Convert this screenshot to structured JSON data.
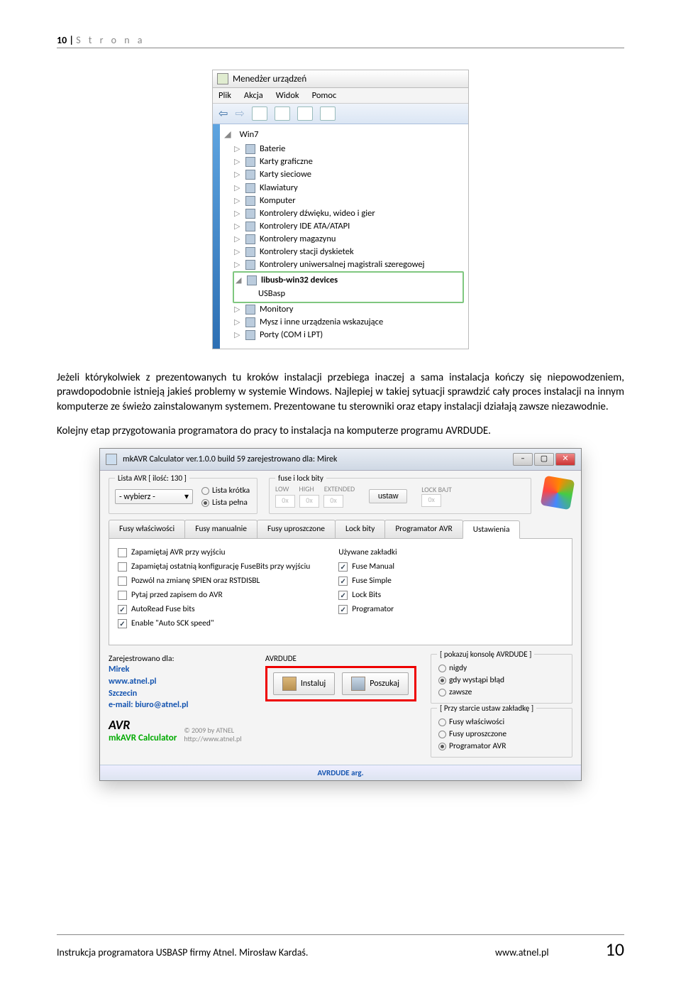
{
  "header": {
    "num": "10 | ",
    "label": "S t r o n a"
  },
  "devmgr": {
    "title": "Menedżer urządzeń",
    "menu": [
      "Plik",
      "Akcja",
      "Widok",
      "Pomoc"
    ],
    "root": "Win7",
    "items": [
      "Baterie",
      "Karty graficzne",
      "Karty sieciowe",
      "Klawiatury",
      "Komputer",
      "Kontrolery dźwięku, wideo i gier",
      "Kontrolery IDE ATA/ATAPI",
      "Kontrolery magazynu",
      "Kontrolery stacji dyskietek",
      "Kontrolery uniwersalnej magistrali szeregowej"
    ],
    "highlighted": {
      "parent": "libusb-win32 devices",
      "child": "USBasp"
    },
    "after": [
      "Monitory",
      "Mysz i inne urządzenia wskazujące",
      "Porty (COM i LPT)"
    ]
  },
  "para1": "Jeżeli którykolwiek z prezentowanych tu kroków instalacji przebiega inaczej a sama instalacja kończy się niepowodzeniem, prawdopodobnie istnieją jakieś problemy w systemie Windows. Najlepiej w takiej sytuacji sprawdzić cały proces instalacji na innym komputerze ze świeżo zainstalowanym systemem. Prezentowane tu sterowniki oraz etapy instalacji działają zawsze niezawodnie.",
  "para2": "Kolejny etap przygotowania programatora do pracy to instalacja na komputerze programu AVRDUDE.",
  "mkavr": {
    "title": "mkAVR Calculator ver.1.0.0 build 59  zarejestrowano dla: Mirek",
    "lista_label": "Lista AVR [ ilość: 130 ]",
    "select_value": "- wybierz -",
    "radio_short": "Lista krótka",
    "radio_full": "Lista pełna",
    "fuse_title": "fuse i lock bity",
    "fuse_cols": [
      "LOW",
      "HIGH",
      "EXTENDED"
    ],
    "hex": "0x",
    "ustaw": "ustaw",
    "lockbajt": "LOCK BAJT",
    "tabs": [
      "Fusy właściwości",
      "Fusy manualnie",
      "Fusy uproszczone",
      "Lock bity",
      "Programator AVR",
      "Ustawienia"
    ],
    "left_checks": [
      {
        "label": "Zapamiętaj AVR przy wyjściu",
        "checked": false
      },
      {
        "label": "Zapamiętaj ostatnią konfigurację FuseBits przy wyjściu",
        "checked": false
      },
      {
        "label": "Pozwól na zmianę SPIEN oraz RSTDISBL",
        "checked": false
      },
      {
        "label": "Pytaj przed zapisem do AVR",
        "checked": false
      },
      {
        "label": "AutoRead Fuse bits",
        "checked": true
      },
      {
        "label": "Enable \"Auto SCK speed\"",
        "checked": true
      }
    ],
    "uzk_title": "Używane zakładki",
    "right_checks": [
      {
        "label": "Fuse Manual",
        "checked": true
      },
      {
        "label": "Fuse Simple",
        "checked": true
      },
      {
        "label": "Lock Bits",
        "checked": true
      },
      {
        "label": "Programator",
        "checked": true
      }
    ],
    "reg_label": "Zarejestrowano dla:",
    "reg": [
      "Mirek",
      "www.atnel.pl",
      "Szczecin",
      "e-mail: biuro@atnel.pl"
    ],
    "konsola_label": "[ pokazuj konsolę AVRDUDE ]",
    "konsola_opts": [
      {
        "label": "nigdy",
        "checked": false
      },
      {
        "label": "gdy wystąpi błąd",
        "checked": true
      },
      {
        "label": "zawsze",
        "checked": false
      }
    ],
    "start_label": "[ Przy starcie ustaw zakładkę ]",
    "start_opts": [
      {
        "label": "Fusy właściwości",
        "checked": false
      },
      {
        "label": "Fusy uproszczone",
        "checked": false
      },
      {
        "label": "Programator AVR",
        "checked": true
      }
    ],
    "avrdude_label": "AVRDUDE",
    "instaluj": "Instaluj",
    "poszukaj": "Poszukaj",
    "logo": "AVR",
    "calc_name": "mkAVR Calculator",
    "copy1": "© 2009 by ATNEL",
    "copy2": "http://www.atnel.pl",
    "statusbar": "AVRDUDE arg."
  },
  "footer": {
    "text": "Instrukcja programatora USBASP firmy Atnel. Mirosław Kardaś.",
    "url": "www.atnel.pl",
    "page": "10"
  }
}
